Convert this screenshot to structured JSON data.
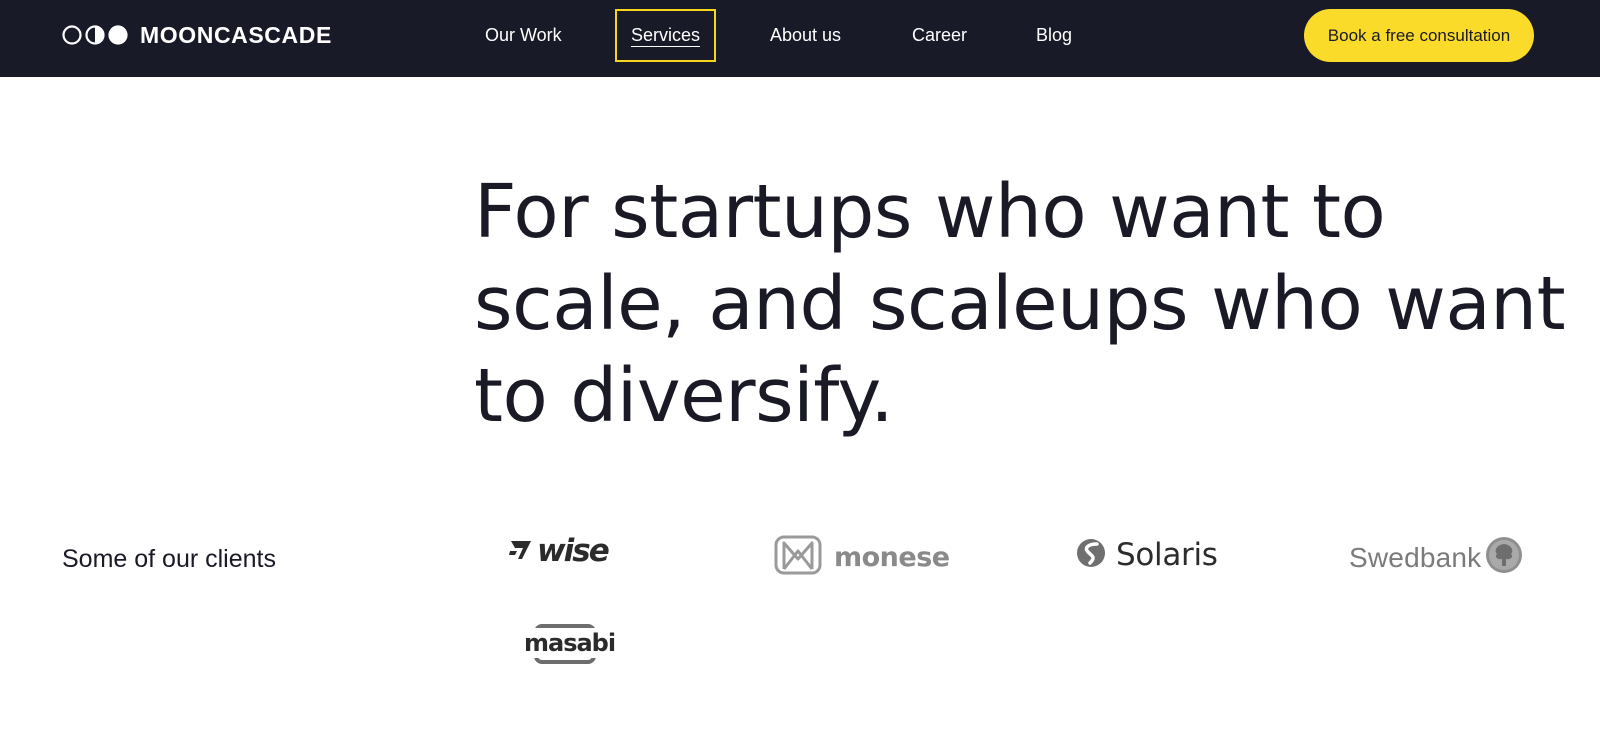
{
  "header": {
    "brand": {
      "name": "MOONCASCADE",
      "mark_icon": "moon-phases-icon"
    },
    "nav": [
      {
        "label": "Our Work",
        "active": false
      },
      {
        "label": "Services",
        "active": true
      },
      {
        "label": "About us",
        "active": false
      },
      {
        "label": "Career",
        "active": false
      },
      {
        "label": "Blog",
        "active": false
      }
    ],
    "cta_label": "Book a free consultation"
  },
  "hero": {
    "headline": "For startups who want to scale, and scaleups who want to diversify."
  },
  "clients": {
    "label": "Some of our clients",
    "logos": [
      {
        "name": "wise",
        "icon": "wise-flag-icon"
      },
      {
        "name": "monese",
        "icon": "monese-m-icon"
      },
      {
        "name": "Solaris",
        "icon": "solaris-s-icon"
      },
      {
        "name": "Swedbank",
        "icon": "swedbank-tree-icon"
      },
      {
        "name": "masabi",
        "icon": "masabi-frame-icon"
      }
    ]
  },
  "colors": {
    "header_bg": "#191a28",
    "accent_yellow": "#fbdb2a",
    "text_dark": "#191a26"
  }
}
